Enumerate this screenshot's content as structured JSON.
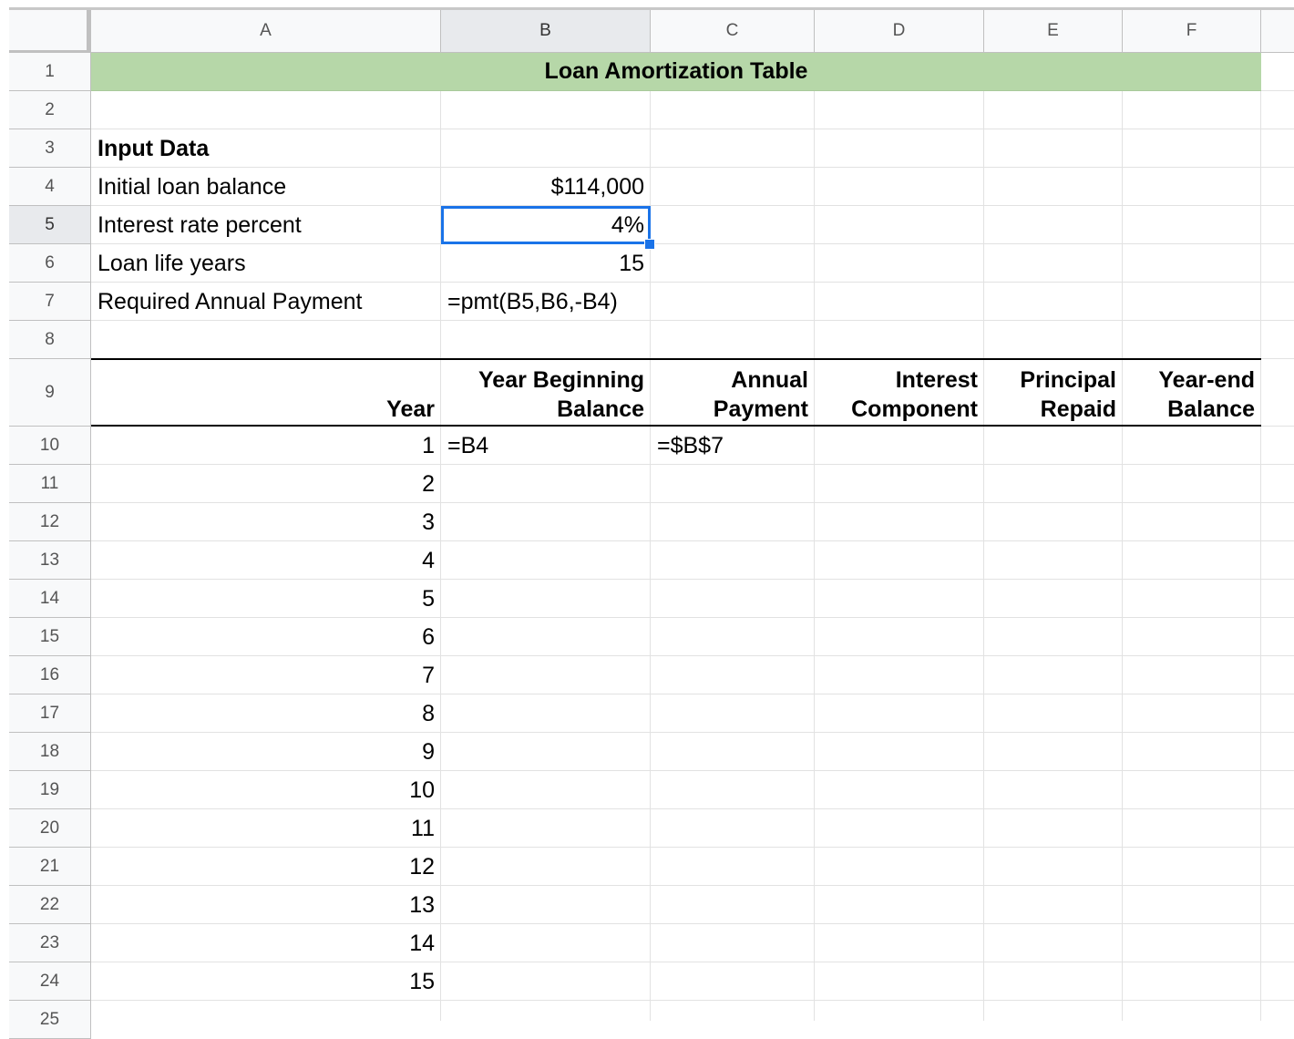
{
  "columns": [
    "A",
    "B",
    "C",
    "D",
    "E",
    "F"
  ],
  "rows": [
    "1",
    "2",
    "3",
    "4",
    "5",
    "6",
    "7",
    "8",
    "9",
    "10",
    "11",
    "12",
    "13",
    "14",
    "15",
    "16",
    "17",
    "18",
    "19",
    "20",
    "21",
    "22",
    "23",
    "24",
    "25"
  ],
  "title": "Loan Amortization Table",
  "input": {
    "heading": "Input Data",
    "labels": [
      "Initial loan balance",
      "Interest rate percent",
      "Loan life years",
      "Required Annual Payment"
    ],
    "values": [
      "$114,000",
      "4%",
      "15",
      "=pmt(B5,B6,-B4)"
    ]
  },
  "table_headers": {
    "year": "Year",
    "beginning_1": "Year Beginning",
    "beginning_2": "Balance",
    "payment_1": "Annual",
    "payment_2": "Payment",
    "interest_1": "Interest",
    "interest_2": "Component",
    "principal_1": "Principal",
    "principal_2": "Repaid",
    "yearend_1": "Year-end",
    "yearend_2": "Balance"
  },
  "years": [
    "1",
    "2",
    "3",
    "4",
    "5",
    "6",
    "7",
    "8",
    "9",
    "10",
    "11",
    "12",
    "13",
    "14",
    "15"
  ],
  "row10": {
    "beginning": "=B4",
    "payment": "=$B$7"
  },
  "selection": {
    "cell": "B5"
  },
  "colors": {
    "title_band": "#b6d7a8",
    "selection": "#1a73e8",
    "header_bg": "#f8f9fa"
  }
}
